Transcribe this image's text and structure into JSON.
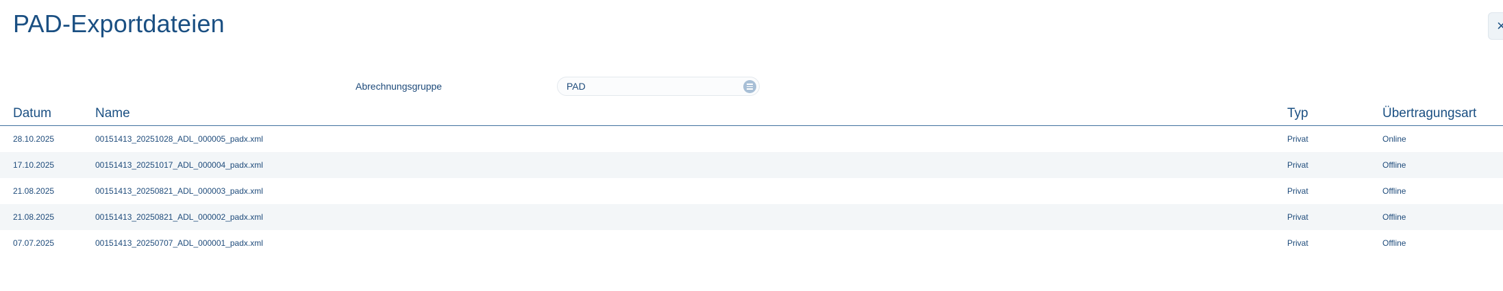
{
  "header": {
    "title": "PAD-Exportdateien",
    "close_label": "×"
  },
  "filter": {
    "label": "Abrechnungsgruppe",
    "value": "PAD"
  },
  "table": {
    "columns": {
      "datum": "Datum",
      "name": "Name",
      "typ": "Typ",
      "art": "Übertragungsart"
    },
    "rows": [
      {
        "datum": "28.10.2025",
        "name": "00151413_20251028_ADL_000005_padx.xml",
        "typ": "Privat",
        "art": "Online"
      },
      {
        "datum": "17.10.2025",
        "name": "00151413_20251017_ADL_000004_padx.xml",
        "typ": "Privat",
        "art": "Offline"
      },
      {
        "datum": "21.08.2025",
        "name": "00151413_20250821_ADL_000003_padx.xml",
        "typ": "Privat",
        "art": "Offline"
      },
      {
        "datum": "21.08.2025",
        "name": "00151413_20250821_ADL_000002_padx.xml",
        "typ": "Privat",
        "art": "Offline"
      },
      {
        "datum": "07.07.2025",
        "name": "00151413_20250707_ADL_000001_padx.xml",
        "typ": "Privat",
        "art": "Offline"
      }
    ]
  }
}
